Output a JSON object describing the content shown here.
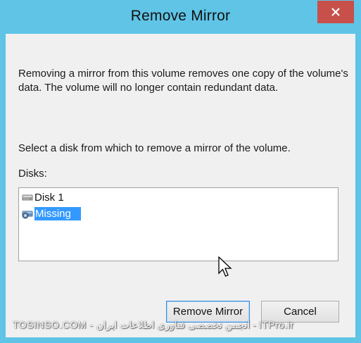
{
  "window": {
    "title": "Remove Mirror"
  },
  "content": {
    "description": "Removing a mirror from this volume removes one copy of the volume's data. The volume will no longer contain redundant data.",
    "select_prompt": "Select a disk from which to remove a mirror of the volume.",
    "disks_label": "Disks:",
    "disks": [
      {
        "label": "Disk 1",
        "icon": "disk-icon",
        "selected": false
      },
      {
        "label": "Missing",
        "icon": "missing-disk-icon",
        "selected": true
      }
    ]
  },
  "buttons": {
    "remove_label": "Remove Mirror",
    "cancel_label": "Cancel"
  },
  "watermark": "TOSINSO.COM - انجمن تخصصی فناوری اطلاعات ایران - ITPro.ir",
  "colors": {
    "titlebar": "#5fc4e6",
    "close_button": "#c7504b",
    "selection": "#3399ff"
  }
}
